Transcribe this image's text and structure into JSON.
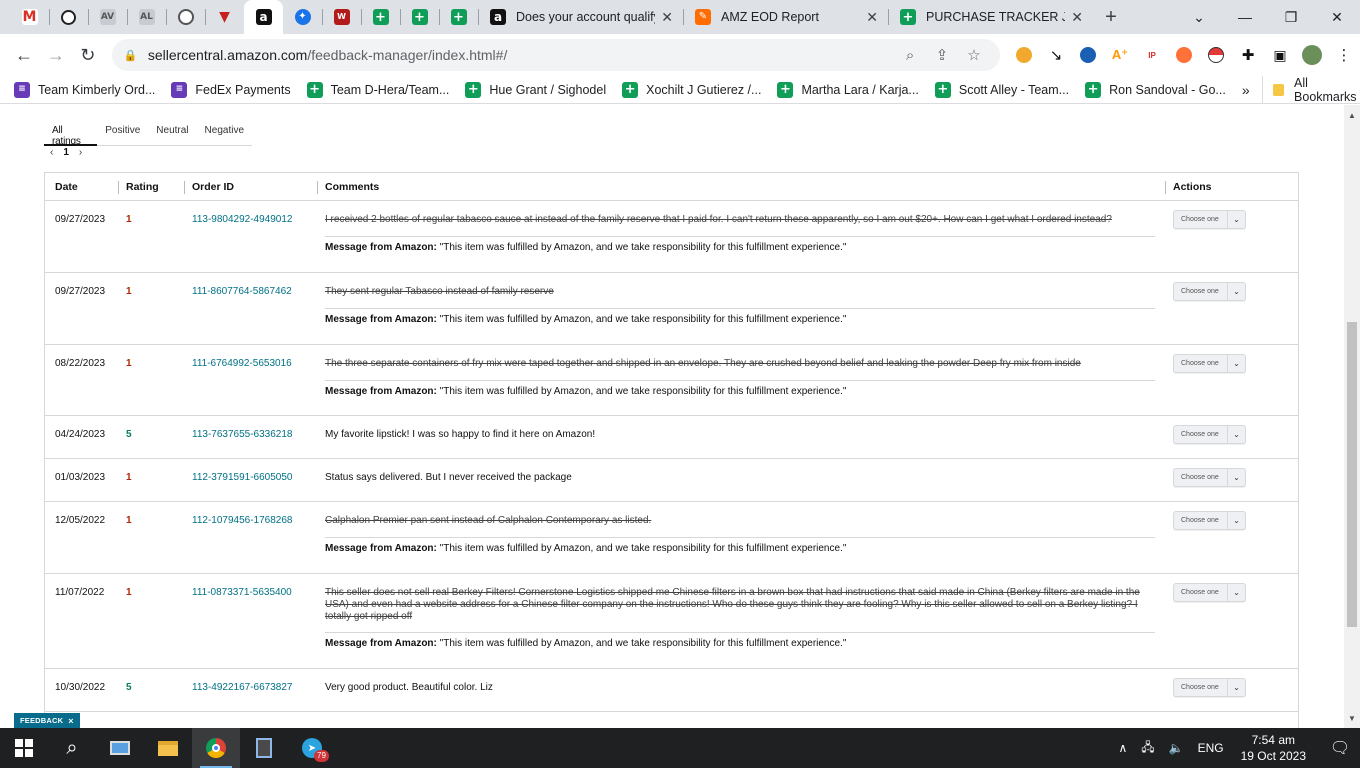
{
  "browser": {
    "pinned_tabs": [
      {
        "icon": "gmail-icon",
        "glyph": "M",
        "cls": "fav-gmail"
      },
      {
        "icon": "openai-icon",
        "glyph": "",
        "cls": "fav-openai"
      },
      {
        "icon": "app-icon",
        "glyph": "AV",
        "cls": "fav-grey"
      },
      {
        "icon": "app-icon-2",
        "glyph": "AL",
        "cls": "fav-grey"
      },
      {
        "icon": "globe-icon",
        "glyph": "",
        "cls": "fav-globe"
      },
      {
        "icon": "triangle-icon",
        "glyph": "▼",
        "cls": "fav-tri"
      },
      {
        "icon": "amazon-icon",
        "glyph": "a",
        "cls": "fav-amazon"
      },
      {
        "icon": "circle-app-icon",
        "glyph": "✦",
        "cls": "fav-blue"
      },
      {
        "icon": "w-app-icon",
        "glyph": "W",
        "cls": "fav-red"
      },
      {
        "icon": "sheets-icon",
        "glyph": "+",
        "cls": "fav-sheets"
      },
      {
        "icon": "sheets-icon",
        "glyph": "+",
        "cls": "fav-sheets"
      },
      {
        "icon": "sheets-icon",
        "glyph": "+",
        "cls": "fav-sheets"
      }
    ],
    "tabs": [
      {
        "title": "Does your account qualify",
        "glyph": "a",
        "cls": "fav-amazon",
        "icon": "amazon-icon"
      },
      {
        "title": "AMZ EOD Report",
        "glyph": "✎",
        "cls": "fav-amz",
        "icon": "report-icon"
      },
      {
        "title": "PURCHASE TRACKER JUN",
        "glyph": "+",
        "cls": "fav-sheets",
        "icon": "sheets-icon"
      }
    ],
    "url_host": "sellercentral.amazon.com",
    "url_path": "/feedback-manager/index.html#/",
    "bookmarks": [
      {
        "label": "Team Kimberly Ord...",
        "glyph": "≡",
        "cls": "fav-forms"
      },
      {
        "label": "FedEx Payments",
        "glyph": "≡",
        "cls": "fav-forms"
      },
      {
        "label": "Team D-Hera/Team...",
        "glyph": "+",
        "cls": "fav-sheets"
      },
      {
        "label": "Hue Grant / Sighodel",
        "glyph": "+",
        "cls": "fav-sheets"
      },
      {
        "label": "Xochilt J Gutierez /...",
        "glyph": "+",
        "cls": "fav-sheets"
      },
      {
        "label": "Martha Lara / Karja...",
        "glyph": "+",
        "cls": "fav-sheets"
      },
      {
        "label": "Scott Alley - Team...",
        "glyph": "+",
        "cls": "fav-sheets"
      },
      {
        "label": "Ron Sandoval - Go...",
        "glyph": "+",
        "cls": "fav-sheets"
      }
    ],
    "all_bookmarks": "All Bookmarks"
  },
  "feedback": {
    "rating_tabs": [
      "All ratings",
      "Positive",
      "Neutral",
      "Negative"
    ],
    "pager": {
      "prev": "‹",
      "current": "1",
      "next": "›"
    },
    "columns": {
      "date": "Date",
      "rating": "Rating",
      "order": "Order ID",
      "comments": "Comments",
      "actions": "Actions"
    },
    "msg_label": "Message from Amazon:",
    "msg_text": "\"This item was fulfilled by Amazon, and we take responsibility for this fulfillment experience.\"",
    "action_label": "Choose one",
    "rows": [
      {
        "date": "09/27/2023",
        "rating": "1",
        "order": "113-9804292-4949012",
        "comment": "I received 2 bottles of regular tabasco sauce at instead of the family reserve that I paid for. I can't return these apparently, so I am out $20+. How can I get what I ordered instead?",
        "struck": true,
        "msg": true,
        "height": 72,
        "msgTop": 35
      },
      {
        "date": "09/27/2023",
        "rating": "1",
        "order": "111-8607764-5867462",
        "comment": "They sent regular Tabasco instead of family reserve",
        "struck": true,
        "msg": true,
        "height": 72,
        "msgTop": 35
      },
      {
        "date": "08/22/2023",
        "rating": "1",
        "order": "111-6764992-5653016",
        "comment": "The three separate containers of fry mix were taped together and shipped in an envelope. They are crushed beyond belief and leaking the powder Deep fry mix from inside",
        "struck": true,
        "msg": true,
        "height": 71,
        "msgTop": 35
      },
      {
        "date": "04/24/2023",
        "rating": "5",
        "order": "113-7637655-6336218",
        "comment": "My favorite lipstick! I was so happy to find it here on Amazon!",
        "struck": false,
        "msg": false,
        "height": 43
      },
      {
        "date": "01/03/2023",
        "rating": "1",
        "order": "112-3791591-6605050",
        "comment": "Status says delivered. But I never received the package",
        "struck": false,
        "msg": false,
        "height": 43
      },
      {
        "date": "12/05/2022",
        "rating": "1",
        "order": "112-1079456-1768268",
        "comment": "Calphalon Premier pan sent instead of Calphalon Contemporary as listed.",
        "struck": true,
        "msg": true,
        "height": 72,
        "msgTop": 35
      },
      {
        "date": "11/07/2022",
        "rating": "1",
        "order": "111-0873371-5635400",
        "comment": "This seller does not sell real Berkey Filters! Cornerstone Logistics shipped me Chinese filters in a brown box that had instructions that said made in China (Berkey filters are made in the USA) and even had a website address for a Chinese filter company on the instructions! Who do these guys think they are fooling? Why is this seller allowed to sell on a Berkey listing? I totally got ripped off",
        "struck": true,
        "msg": true,
        "height": 95,
        "msgTop": 58
      },
      {
        "date": "10/30/2022",
        "rating": "5",
        "order": "113-4922167-6673827",
        "comment": "Very good product. Beautiful color. Liz",
        "struck": false,
        "msg": false,
        "height": 43
      }
    ]
  },
  "feedback_badge": "FEEDBACK",
  "taskbar": {
    "time": "7:54 am",
    "date": "19 Oct 2023",
    "lang": "ENG",
    "telegram_badge": "79"
  }
}
